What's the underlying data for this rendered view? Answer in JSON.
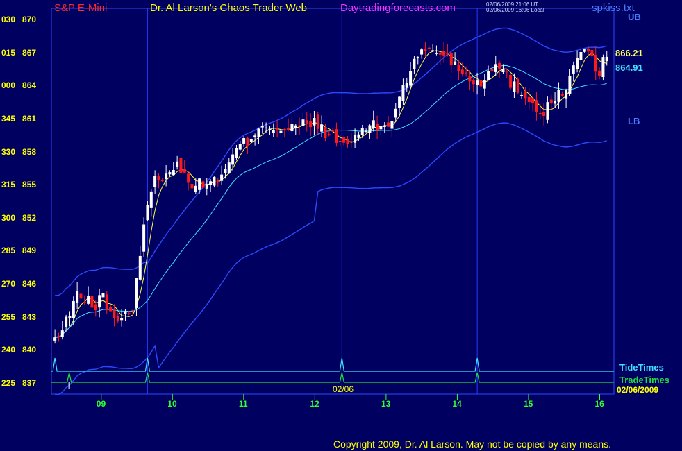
{
  "header": {
    "symbol": "S&P E-Mini",
    "website_title": "Dr. Al Larson's Chaos Trader Web",
    "site_name": "Daytradingforecasts.com",
    "stamp_ut": "02/06/2009 21:06 UT",
    "stamp_local": "02/06/2009 16:06 Local",
    "file_name": "spkiss.txt"
  },
  "labels": {
    "upper_band": "UB",
    "lower_band": "LB",
    "last_price_fast": "866.21",
    "last_price_slow": "864.91",
    "tide_times": "TideTimes",
    "trade_times": "TradeTimes",
    "chart_date": "02/06/2009",
    "midday_marker": "02/06",
    "copyright": "Copyright 2009, Dr. Al Larson. May not be copied by any means."
  },
  "colors": {
    "background": "#000060",
    "bull_candle": "#ffffff",
    "bear_candle": "#ff1a1a",
    "fast_ma": "#ffff40",
    "slow_ma": "#40e0ff",
    "band": "#2a4aff",
    "tide": "#40e0ff",
    "trade": "#20e040",
    "axis_text": "#ffff00",
    "time_text": "#30ff30"
  },
  "chart_data": {
    "type": "candlestick",
    "y_axis": {
      "range": [
        836,
        871
      ],
      "ticks": [
        {
          "left": "030",
          "price": "870",
          "value": 870
        },
        {
          "left": "015",
          "price": "867",
          "value": 867
        },
        {
          "left": "000",
          "price": "864",
          "value": 864
        },
        {
          "left": "345",
          "price": "861",
          "value": 861
        },
        {
          "left": "330",
          "price": "858",
          "value": 858
        },
        {
          "left": "315",
          "price": "855",
          "value": 855
        },
        {
          "left": "300",
          "price": "852",
          "value": 852
        },
        {
          "left": "285",
          "price": "849",
          "value": 849
        },
        {
          "left": "270",
          "price": "846",
          "value": 846
        },
        {
          "left": "255",
          "price": "843",
          "value": 843
        },
        {
          "left": "240",
          "price": "840",
          "value": 840
        },
        {
          "left": "225",
          "price": "837",
          "value": 837
        }
      ]
    },
    "x_axis": {
      "range": [
        8.3,
        16.2
      ],
      "ticks": [
        {
          "label": "09",
          "value": 9
        },
        {
          "label": "10",
          "value": 10
        },
        {
          "label": "11",
          "value": 11
        },
        {
          "label": "12",
          "value": 12
        },
        {
          "label": "13",
          "value": 13
        },
        {
          "label": "14",
          "value": 14
        },
        {
          "label": "15",
          "value": 15
        },
        {
          "label": "16",
          "value": 16
        }
      ]
    },
    "close_path": [
      [
        8.3,
        840.6
      ],
      [
        8.42,
        841.4
      ],
      [
        8.52,
        842.6
      ],
      [
        8.62,
        844.6
      ],
      [
        8.72,
        845.2
      ],
      [
        8.82,
        844.4
      ],
      [
        8.92,
        843.8
      ],
      [
        9.0,
        845.3
      ],
      [
        9.08,
        844.0
      ],
      [
        9.18,
        843.0
      ],
      [
        9.3,
        842.8
      ],
      [
        9.45,
        843.5
      ],
      [
        9.55,
        849.3
      ],
      [
        9.62,
        852.6
      ],
      [
        9.75,
        855.3
      ],
      [
        9.9,
        856.2
      ],
      [
        10.05,
        856.8
      ],
      [
        10.2,
        855.6
      ],
      [
        10.35,
        854.9
      ],
      [
        10.55,
        855.4
      ],
      [
        10.72,
        855.8
      ],
      [
        10.9,
        858.3
      ],
      [
        11.05,
        858.9
      ],
      [
        11.25,
        860.6
      ],
      [
        11.42,
        860.2
      ],
      [
        11.6,
        859.9
      ],
      [
        11.8,
        860.4
      ],
      [
        12.0,
        860.6
      ],
      [
        12.2,
        859.5
      ],
      [
        12.38,
        858.6
      ],
      [
        12.52,
        859.0
      ],
      [
        12.7,
        860.2
      ],
      [
        12.9,
        860.3
      ],
      [
        13.05,
        860.4
      ],
      [
        13.2,
        863.3
      ],
      [
        13.35,
        865.6
      ],
      [
        13.5,
        867.0
      ],
      [
        13.62,
        867.4
      ],
      [
        13.8,
        866.9
      ],
      [
        14.0,
        865.8
      ],
      [
        14.15,
        864.9
      ],
      [
        14.3,
        864.1
      ],
      [
        14.5,
        866.0
      ],
      [
        14.62,
        865.4
      ],
      [
        14.8,
        863.9
      ],
      [
        15.0,
        863.0
      ],
      [
        15.15,
        861.4
      ],
      [
        15.3,
        862.3
      ],
      [
        15.45,
        863.2
      ],
      [
        15.62,
        865.2
      ],
      [
        15.78,
        867.8
      ],
      [
        15.88,
        866.4
      ],
      [
        15.98,
        864.9
      ],
      [
        16.05,
        866.2
      ]
    ],
    "series": [
      {
        "name": "TideTimes",
        "pulses": [
          8.35,
          9.65,
          12.38,
          14.28
        ]
      },
      {
        "name": "TradeTimes",
        "pulses": [
          8.55,
          9.65,
          12.38,
          14.28
        ]
      }
    ],
    "grid": false
  }
}
